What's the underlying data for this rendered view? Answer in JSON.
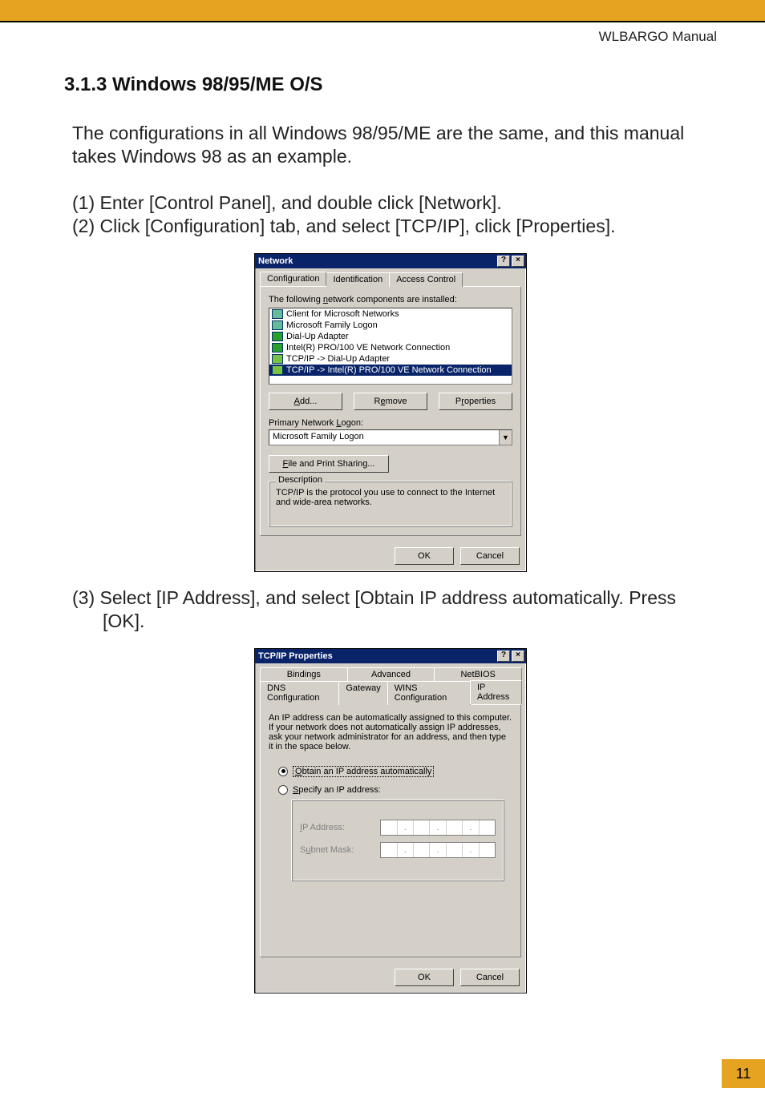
{
  "header": {
    "manual_title": "WLBARGO Manual"
  },
  "section": {
    "heading": "3.1.3 Windows 98/95/ME O/S",
    "intro": "The configurations in all Windows 98/95/ME are the same, and this manual takes Windows 98 as an example.",
    "step1": "(1) Enter [Control Panel], and double click [Network].",
    "step2": "(2) Click [Configuration] tab, and select [TCP/IP], click [Properties].",
    "step3_line1": "(3) Select [IP Address], and select [Obtain IP address automatically. Press",
    "step3_line2": "[OK]."
  },
  "network_dialog": {
    "title": "Network",
    "tabs": [
      "Configuration",
      "Identification",
      "Access Control"
    ],
    "components_label": "The following network components are installed:",
    "items": [
      "Client for Microsoft Networks",
      "Microsoft Family Logon",
      "Dial-Up Adapter",
      "Intel(R) PRO/100 VE Network Connection",
      "TCP/IP -> Dial-Up Adapter",
      "TCP/IP -> Intel(R) PRO/100 VE Network Connection"
    ],
    "add_btn": "Add...",
    "remove_btn": "Remove",
    "properties_btn": "Properties",
    "logon_label": "Primary Network Logon:",
    "logon_value": "Microsoft Family Logon",
    "file_print_btn": "File and Print Sharing...",
    "desc_legend": "Description",
    "desc_text": "TCP/IP is the protocol you use to connect to the Internet and wide-area networks.",
    "ok": "OK",
    "cancel": "Cancel"
  },
  "tcpip_dialog": {
    "title": "TCP/IP Properties",
    "tabs_row1": [
      "Bindings",
      "Advanced",
      "NetBIOS"
    ],
    "tabs_row2": [
      "DNS Configuration",
      "Gateway",
      "WINS Configuration",
      "IP Address"
    ],
    "info": "An IP address can be automatically assigned to this computer. If your network does not automatically assign IP addresses, ask your network administrator for an address, and then type it in the space below.",
    "radio_auto": "Obtain an IP address automatically",
    "radio_specify": "Specify an IP address:",
    "ip_label": "IP Address:",
    "subnet_label": "Subnet Mask:",
    "ok": "OK",
    "cancel": "Cancel"
  },
  "page_number": "11"
}
